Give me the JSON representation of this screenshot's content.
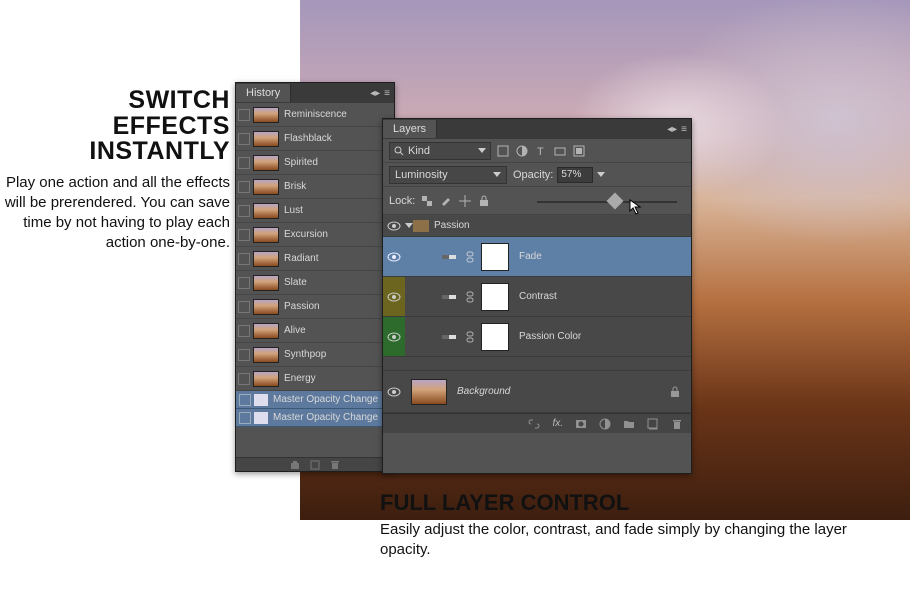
{
  "marketing": {
    "left_heading_line1": "SWITCH",
    "left_heading_line2": "EFFECTS",
    "left_heading_line3": "INSTANTLY",
    "left_body": "Play one action and all the effects will be prerendered. You can save time by not having to play each action one-by-one.",
    "bottom_heading": "FULL LAYER CONTROL",
    "bottom_body": "Easily adjust the color, contrast, and fade simply by changing the layer opacity."
  },
  "history": {
    "tab": "History",
    "items": [
      {
        "label": "Reminiscence"
      },
      {
        "label": "Flashblack"
      },
      {
        "label": "Spirited"
      },
      {
        "label": "Brisk"
      },
      {
        "label": "Lust"
      },
      {
        "label": "Excursion"
      },
      {
        "label": "Radiant"
      },
      {
        "label": "Slate"
      },
      {
        "label": "Passion"
      },
      {
        "label": "Alive"
      },
      {
        "label": "Synthpop"
      },
      {
        "label": "Energy"
      }
    ],
    "actions": [
      {
        "label": "Master Opacity Change"
      },
      {
        "label": "Master Opacity Change"
      }
    ]
  },
  "layers": {
    "tab": "Layers",
    "kind_label": "Kind",
    "blend_mode": "Luminosity",
    "opacity_label": "Opacity:",
    "opacity_value": "57%",
    "lock_label": "Lock:",
    "group_name": "Passion",
    "rows": [
      {
        "name": "Fade"
      },
      {
        "name": "Contrast"
      },
      {
        "name": "Passion Color"
      }
    ],
    "background_label": "Background"
  }
}
